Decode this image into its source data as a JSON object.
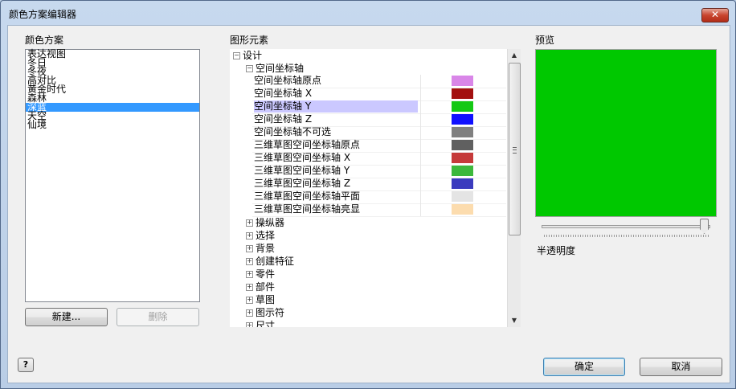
{
  "window": {
    "title": "颜色方案编辑器",
    "close_label": "✕"
  },
  "schemes": {
    "label": "颜色方案",
    "items": [
      "表达视图",
      "冬日",
      "冬夜",
      "高对比",
      "黄金时代",
      "森林",
      "深蓝",
      "天空",
      "仙境"
    ],
    "selected_index": 6,
    "new_button": "新建...",
    "delete_button": "删除"
  },
  "elements": {
    "label": "图形元素",
    "root": "设计",
    "expanded_group": "空间坐标轴",
    "rows": [
      {
        "label": "空间坐标轴原点",
        "color": "#d986e8"
      },
      {
        "label": "空间坐标轴 X",
        "color": "#a31010"
      },
      {
        "label": "空间坐标轴 Y",
        "color": "#14c814"
      },
      {
        "label": "空间坐标轴 Z",
        "color": "#1010ff"
      },
      {
        "label": "空间坐标轴不可选",
        "color": "#808080"
      },
      {
        "label": "三维草图空间坐标轴原点",
        "color": "#606060"
      },
      {
        "label": "三维草图空间坐标轴 X",
        "color": "#c53a3a"
      },
      {
        "label": "三维草图空间坐标轴 Y",
        "color": "#3cb83c"
      },
      {
        "label": "三维草图空间坐标轴 Z",
        "color": "#3b3bbe"
      },
      {
        "label": "三维草图空间坐标轴平面",
        "color": "#e4e4e4"
      },
      {
        "label": "三维草图空间坐标轴亮显",
        "color": "#fcdcae"
      }
    ],
    "selected_row": 2,
    "collapsed_groups": [
      "操纵器",
      "选择",
      "背景",
      "创建特征",
      "零件",
      "部件",
      "草图",
      "图示符",
      "尺寸"
    ]
  },
  "preview": {
    "label": "预览",
    "color": "#00c800",
    "transparency_label": "半透明度",
    "transparency_value": 0.97
  },
  "footer": {
    "help_label": "?",
    "ok_button": "确定",
    "cancel_button": "取消"
  },
  "icons": {
    "expand": "+",
    "collapse": "−",
    "scroll_up": "▲",
    "scroll_down": "▼"
  }
}
